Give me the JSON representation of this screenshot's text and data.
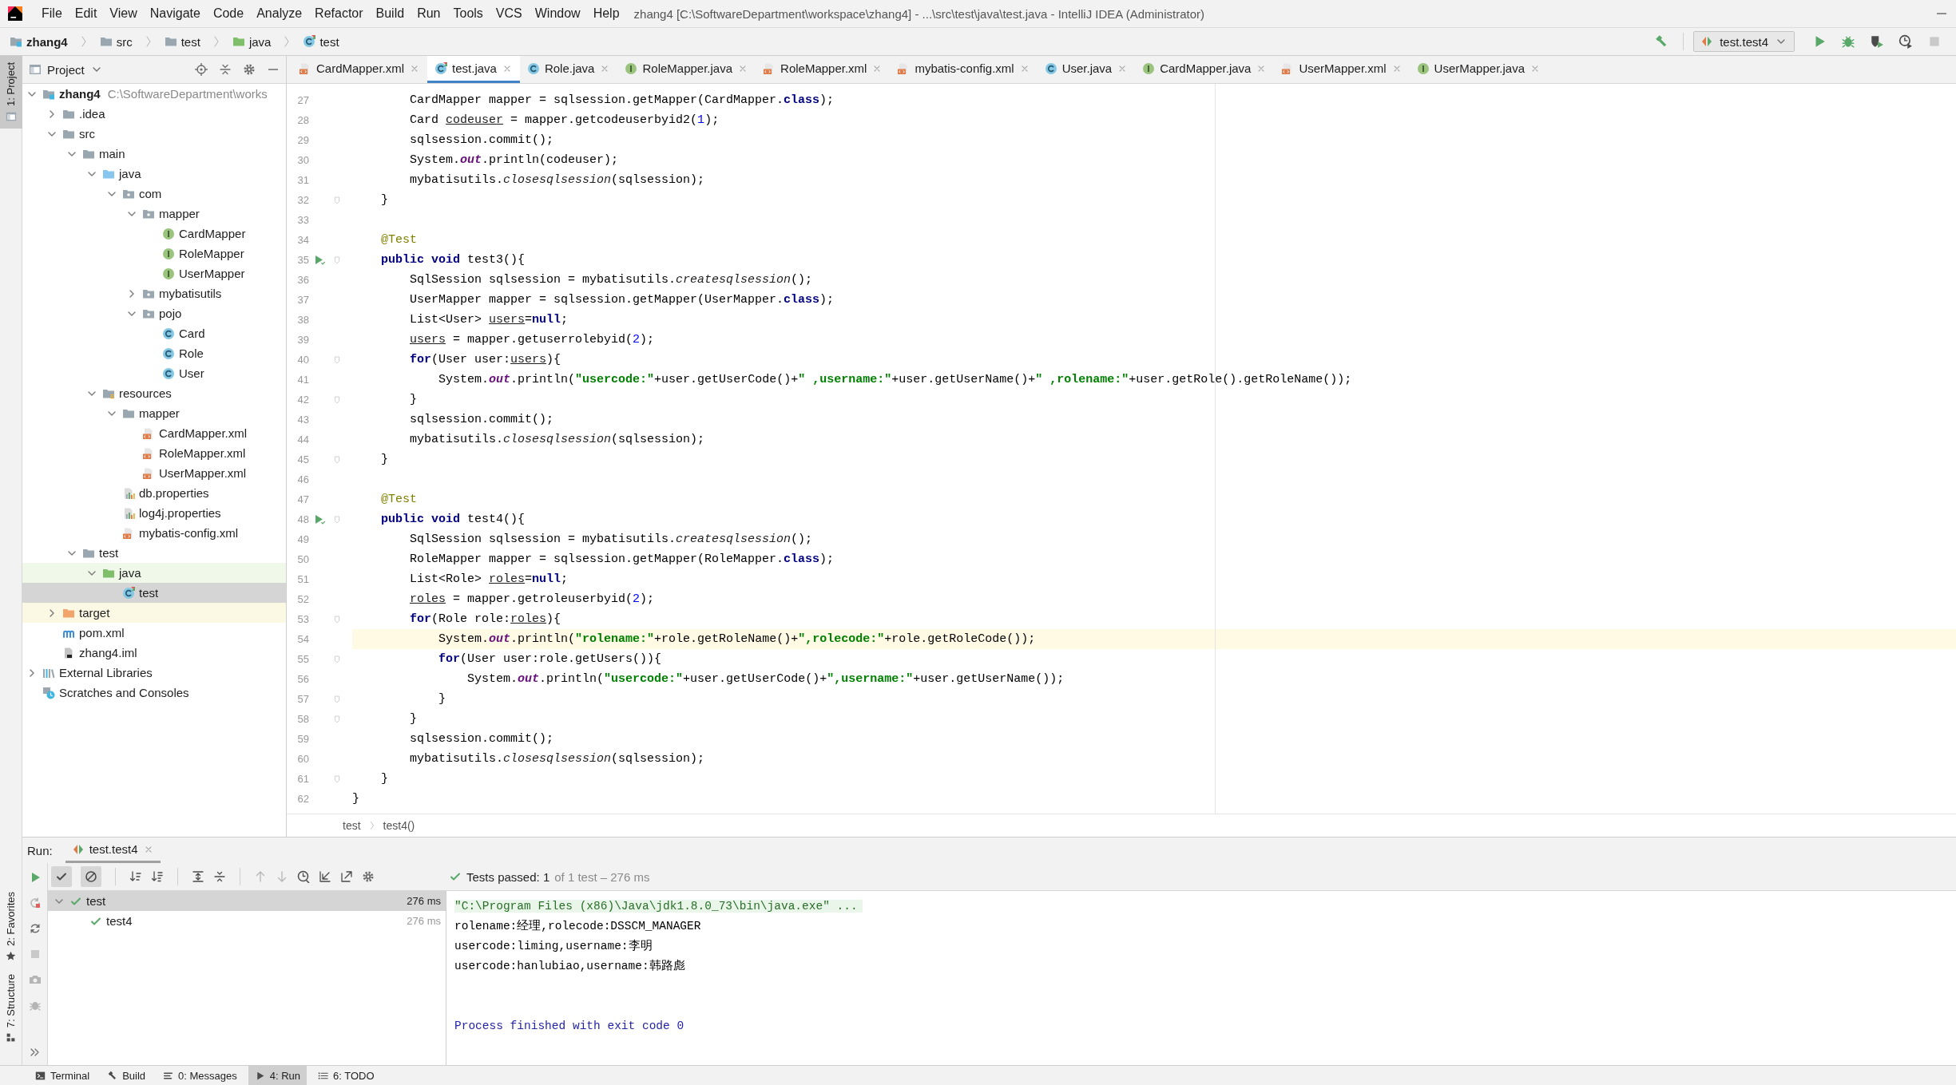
{
  "title_bar": {
    "menu": [
      "File",
      "Edit",
      "View",
      "Navigate",
      "Code",
      "Analyze",
      "Refactor",
      "Build",
      "Run",
      "Tools",
      "VCS",
      "Window",
      "Help"
    ],
    "title": "zhang4 [C:\\SoftwareDepartment\\workspace\\zhang4] - ...\\src\\test\\java\\test.java - IntelliJ IDEA (Administrator)"
  },
  "navigation": {
    "breadcrumbs": [
      {
        "label": "zhang4",
        "kind": "module"
      },
      {
        "label": "src",
        "kind": "folder"
      },
      {
        "label": "test",
        "kind": "folder"
      },
      {
        "label": "java",
        "kind": "test-source-folder"
      },
      {
        "label": "test",
        "kind": "test-class"
      }
    ],
    "run_configuration": "test.test4"
  },
  "tool_strip": {
    "top": [
      {
        "label": "1: Project",
        "selected": true
      }
    ],
    "bottom": [
      {
        "label": "2: Favorites",
        "kind": "favorites",
        "selected": false
      },
      {
        "label": "7: Structure",
        "kind": "structure",
        "selected": false
      }
    ]
  },
  "project": {
    "title": "Project",
    "tree": [
      {
        "name": "zhang4",
        "path": "C:\\SoftwareDepartment\\works",
        "kind": "module",
        "expanded": true,
        "selected": false,
        "children": [
          {
            "name": ".idea",
            "kind": "folder",
            "expanded": false,
            "selected": false
          },
          {
            "name": "src",
            "kind": "folder",
            "expanded": true,
            "selected": false,
            "children": [
              {
                "name": "main",
                "kind": "folder",
                "expanded": true,
                "selected": false,
                "children": [
                  {
                    "name": "java",
                    "kind": "source-folder",
                    "expanded": true,
                    "selected": false,
                    "children": [
                      {
                        "name": "com",
                        "kind": "package",
                        "expanded": true,
                        "selected": false,
                        "children": [
                          {
                            "name": "mapper",
                            "kind": "package",
                            "expanded": true,
                            "selected": false,
                            "children": [
                              {
                                "name": "CardMapper",
                                "kind": "interface",
                                "selected": false
                              },
                              {
                                "name": "RoleMapper",
                                "kind": "interface",
                                "selected": false
                              },
                              {
                                "name": "UserMapper",
                                "kind": "interface",
                                "selected": false
                              }
                            ]
                          },
                          {
                            "name": "mybatisutils",
                            "kind": "package",
                            "expanded": false,
                            "selected": false
                          },
                          {
                            "name": "pojo",
                            "kind": "package",
                            "expanded": true,
                            "selected": false,
                            "children": [
                              {
                                "name": "Card",
                                "kind": "class",
                                "selected": false
                              },
                              {
                                "name": "Role",
                                "kind": "class",
                                "selected": false
                              },
                              {
                                "name": "User",
                                "kind": "class",
                                "selected": false
                              }
                            ]
                          }
                        ]
                      }
                    ]
                  },
                  {
                    "name": "resources",
                    "kind": "resources-folder",
                    "expanded": true,
                    "selected": false,
                    "children": [
                      {
                        "name": "mapper",
                        "kind": "folder",
                        "expanded": true,
                        "selected": false,
                        "children": [
                          {
                            "name": "CardMapper.xml",
                            "kind": "xml",
                            "selected": false
                          },
                          {
                            "name": "RoleMapper.xml",
                            "kind": "xml",
                            "selected": false
                          },
                          {
                            "name": "UserMapper.xml",
                            "kind": "xml",
                            "selected": false
                          }
                        ]
                      },
                      {
                        "name": "db.properties",
                        "kind": "properties",
                        "selected": false
                      },
                      {
                        "name": "log4j.properties",
                        "kind": "properties",
                        "selected": false
                      },
                      {
                        "name": "mybatis-config.xml",
                        "kind": "xml",
                        "selected": false
                      }
                    ]
                  }
                ]
              },
              {
                "name": "test",
                "kind": "folder",
                "expanded": true,
                "selected": false,
                "children": [
                  {
                    "name": "java",
                    "kind": "test-source-folder",
                    "expanded": true,
                    "selected": false,
                    "children": [
                      {
                        "name": "test",
                        "kind": "test-class",
                        "selected": true
                      }
                    ]
                  }
                ]
              }
            ]
          },
          {
            "name": "target",
            "kind": "excluded-folder",
            "expanded": false,
            "selected": false
          },
          {
            "name": "pom.xml",
            "kind": "pom",
            "selected": false
          },
          {
            "name": "zhang4.iml",
            "kind": "iml",
            "selected": false
          }
        ]
      },
      {
        "name": "External Libraries",
        "kind": "libraries",
        "expanded": false,
        "selected": false
      },
      {
        "name": "Scratches and Consoles",
        "kind": "scratches",
        "selected": false
      }
    ]
  },
  "editor": {
    "tabs": [
      {
        "label": "CardMapper.xml",
        "kind": "xml",
        "selected": false
      },
      {
        "label": "test.java",
        "kind": "test-class",
        "selected": true
      },
      {
        "label": "Role.java",
        "kind": "class",
        "selected": false
      },
      {
        "label": "RoleMapper.java",
        "kind": "interface",
        "selected": false
      },
      {
        "label": "RoleMapper.xml",
        "kind": "xml",
        "selected": false
      },
      {
        "label": "mybatis-config.xml",
        "kind": "xml",
        "selected": false
      },
      {
        "label": "User.java",
        "kind": "class",
        "selected": false
      },
      {
        "label": "CardMapper.java",
        "kind": "interface",
        "selected": false
      },
      {
        "label": "UserMapper.xml",
        "kind": "xml",
        "selected": false
      },
      {
        "label": "UserMapper.java",
        "kind": "interface",
        "selected": false
      }
    ],
    "lines": [
      {
        "number": "27",
        "tokens": [
          {
            "kind": "plain",
            "text": "        CardMapper mapper = sqlsession.getMapper(CardMapper."
          },
          {
            "kind": "keyword",
            "text": "class"
          },
          {
            "kind": "plain",
            "text": ");"
          }
        ]
      },
      {
        "number": "28",
        "tokens": [
          {
            "kind": "plain",
            "text": "        Card "
          },
          {
            "kind": "reassigned",
            "text": "codeuser"
          },
          {
            "kind": "plain",
            "text": " = mapper.getcodeuserbyid2("
          },
          {
            "kind": "number",
            "text": "1"
          },
          {
            "kind": "plain",
            "text": ");"
          }
        ]
      },
      {
        "number": "29",
        "tokens": [
          {
            "kind": "plain",
            "text": "        sqlsession.commit();"
          }
        ]
      },
      {
        "number": "30",
        "tokens": [
          {
            "kind": "plain",
            "text": "        System."
          },
          {
            "kind": "static-field",
            "text": "out"
          },
          {
            "kind": "plain",
            "text": ".println(codeuser);"
          }
        ]
      },
      {
        "number": "31",
        "tokens": [
          {
            "kind": "plain",
            "text": "        mybatisutils."
          },
          {
            "kind": "static-call",
            "text": "closesqlsession"
          },
          {
            "kind": "plain",
            "text": "(sqlsession);"
          }
        ]
      },
      {
        "number": "32",
        "fold": true,
        "tokens": [
          {
            "kind": "plain",
            "text": "    }"
          }
        ]
      },
      {
        "number": "33"
      },
      {
        "number": "34",
        "tokens": [
          {
            "kind": "annotation",
            "text": "    @Test"
          }
        ]
      },
      {
        "number": "35",
        "run_marker": true,
        "fold": true,
        "tokens": [
          {
            "kind": "keyword",
            "text": "    public void"
          },
          {
            "kind": "plain",
            "text": " test3(){"
          }
        ]
      },
      {
        "number": "36",
        "tokens": [
          {
            "kind": "plain",
            "text": "        SqlSession sqlsession = mybatisutils."
          },
          {
            "kind": "static-call",
            "text": "createsqlsession"
          },
          {
            "kind": "plain",
            "text": "();"
          }
        ]
      },
      {
        "number": "37",
        "tokens": [
          {
            "kind": "plain",
            "text": "        UserMapper mapper = sqlsession.getMapper(UserMapper."
          },
          {
            "kind": "keyword",
            "text": "class"
          },
          {
            "kind": "plain",
            "text": ");"
          }
        ]
      },
      {
        "number": "38",
        "tokens": [
          {
            "kind": "plain",
            "text": "        List<User> "
          },
          {
            "kind": "reassigned",
            "text": "users"
          },
          {
            "kind": "plain",
            "text": "="
          },
          {
            "kind": "keyword",
            "text": "null"
          },
          {
            "kind": "plain",
            "text": ";"
          }
        ]
      },
      {
        "number": "39",
        "tokens": [
          {
            "kind": "reassigned",
            "text": "        users"
          },
          {
            "kind": "plain",
            "text": " = mapper.getuserrolebyid("
          },
          {
            "kind": "number",
            "text": "2"
          },
          {
            "kind": "plain",
            "text": ");"
          }
        ]
      },
      {
        "number": "40",
        "fold": true,
        "tokens": [
          {
            "kind": "keyword",
            "text": "        for"
          },
          {
            "kind": "plain",
            "text": "(User user:"
          },
          {
            "kind": "reassigned",
            "text": "users"
          },
          {
            "kind": "plain",
            "text": "){"
          }
        ]
      },
      {
        "number": "41",
        "tokens": [
          {
            "kind": "plain",
            "text": "            System."
          },
          {
            "kind": "static-field",
            "text": "out"
          },
          {
            "kind": "plain",
            "text": ".println("
          },
          {
            "kind": "string",
            "text": "\"usercode:\""
          },
          {
            "kind": "plain",
            "text": "+user.getUserCode()+"
          },
          {
            "kind": "string",
            "text": "\" ,username:\""
          },
          {
            "kind": "plain",
            "text": "+user.getUserName()+"
          },
          {
            "kind": "string",
            "text": "\" ,rolename:\""
          },
          {
            "kind": "plain",
            "text": "+user.getRole().getRoleName());"
          }
        ]
      },
      {
        "number": "42",
        "fold": true,
        "tokens": [
          {
            "kind": "plain",
            "text": "        }"
          }
        ]
      },
      {
        "number": "43",
        "tokens": [
          {
            "kind": "plain",
            "text": "        sqlsession.commit();"
          }
        ]
      },
      {
        "number": "44",
        "tokens": [
          {
            "kind": "plain",
            "text": "        mybatisutils."
          },
          {
            "kind": "static-call",
            "text": "closesqlsession"
          },
          {
            "kind": "plain",
            "text": "(sqlsession);"
          }
        ]
      },
      {
        "number": "45",
        "fold": true,
        "tokens": [
          {
            "kind": "plain",
            "text": "    }"
          }
        ]
      },
      {
        "number": "46"
      },
      {
        "number": "47",
        "tokens": [
          {
            "kind": "annotation",
            "text": "    @Test"
          }
        ]
      },
      {
        "number": "48",
        "run_marker": true,
        "fold": true,
        "tokens": [
          {
            "kind": "keyword",
            "text": "    public void"
          },
          {
            "kind": "plain",
            "text": " test4(){"
          }
        ]
      },
      {
        "number": "49",
        "tokens": [
          {
            "kind": "plain",
            "text": "        SqlSession sqlsession = mybatisutils."
          },
          {
            "kind": "static-call",
            "text": "createsqlsession"
          },
          {
            "kind": "plain",
            "text": "();"
          }
        ]
      },
      {
        "number": "50",
        "tokens": [
          {
            "kind": "plain",
            "text": "        RoleMapper mapper = sqlsession.getMapper(RoleMapper."
          },
          {
            "kind": "keyword",
            "text": "class"
          },
          {
            "kind": "plain",
            "text": ");"
          }
        ]
      },
      {
        "number": "51",
        "tokens": [
          {
            "kind": "plain",
            "text": "        List<Role> "
          },
          {
            "kind": "reassigned",
            "text": "roles"
          },
          {
            "kind": "plain",
            "text": "="
          },
          {
            "kind": "keyword",
            "text": "null"
          },
          {
            "kind": "plain",
            "text": ";"
          }
        ]
      },
      {
        "number": "52",
        "tokens": [
          {
            "kind": "reassigned",
            "text": "        roles"
          },
          {
            "kind": "plain",
            "text": " = mapper.getroleuserbyid("
          },
          {
            "kind": "number",
            "text": "2"
          },
          {
            "kind": "plain",
            "text": ");"
          }
        ]
      },
      {
        "number": "53",
        "fold": true,
        "tokens": [
          {
            "kind": "keyword",
            "text": "        for"
          },
          {
            "kind": "plain",
            "text": "(Role role:"
          },
          {
            "kind": "reassigned",
            "text": "roles"
          },
          {
            "kind": "plain",
            "text": "){"
          }
        ]
      },
      {
        "number": "54",
        "current": true,
        "tokens": [
          {
            "kind": "plain",
            "text": "            System."
          },
          {
            "kind": "static-field",
            "text": "out"
          },
          {
            "kind": "plain",
            "text": ".println("
          },
          {
            "kind": "string",
            "text": "\"rolename:\""
          },
          {
            "kind": "plain",
            "text": "+role.getRoleName()+"
          },
          {
            "kind": "string",
            "text": "\",rolecode:\""
          },
          {
            "kind": "plain",
            "text": "+role.getRoleCode());"
          }
        ]
      },
      {
        "number": "55",
        "fold": true,
        "tokens": [
          {
            "kind": "keyword",
            "text": "            for"
          },
          {
            "kind": "plain",
            "text": "(User user:role.getUsers()){"
          }
        ]
      },
      {
        "number": "56",
        "tokens": [
          {
            "kind": "plain",
            "text": "                System."
          },
          {
            "kind": "static-field",
            "text": "out"
          },
          {
            "kind": "plain",
            "text": ".println("
          },
          {
            "kind": "string",
            "text": "\"usercode:\""
          },
          {
            "kind": "plain",
            "text": "+user.getUserCode()+"
          },
          {
            "kind": "string",
            "text": "\",username:\""
          },
          {
            "kind": "plain",
            "text": "+user.getUserName());"
          }
        ]
      },
      {
        "number": "57",
        "fold": true,
        "tokens": [
          {
            "kind": "plain",
            "text": "            }"
          }
        ]
      },
      {
        "number": "58",
        "fold": true,
        "tokens": [
          {
            "kind": "plain",
            "text": "        }"
          }
        ]
      },
      {
        "number": "59",
        "tokens": [
          {
            "kind": "plain",
            "text": "        sqlsession.commit();"
          }
        ]
      },
      {
        "number": "60",
        "tokens": [
          {
            "kind": "plain",
            "text": "        mybatisutils."
          },
          {
            "kind": "static-call",
            "text": "closesqlsession"
          },
          {
            "kind": "plain",
            "text": "(sqlsession);"
          }
        ]
      },
      {
        "number": "61",
        "fold": true,
        "tokens": [
          {
            "kind": "plain",
            "text": "    }"
          }
        ]
      },
      {
        "number": "62",
        "tokens": [
          {
            "kind": "plain",
            "text": "}"
          }
        ]
      }
    ],
    "breadcrumbs": [
      "test",
      "test4()"
    ]
  },
  "run": {
    "title": "Run:",
    "tab": "test.test4",
    "show_passed": true,
    "show_ignored": true,
    "status": "Tests passed: 1",
    "status_detail": "of 1 test – 276 ms",
    "tests": [
      {
        "name": "test",
        "time": "276 ms",
        "passed": true,
        "expanded": true,
        "selected": true,
        "children": [
          {
            "name": "test4",
            "time": "276 ms",
            "passed": true,
            "selected": false
          }
        ]
      }
    ],
    "console": [
      {
        "kind": "command",
        "text": "\"C:\\Program Files (x86)\\Java\\jdk1.8.0_73\\bin\\java.exe\" ..."
      },
      {
        "kind": "output",
        "text": "rolename:经理,rolecode:DSSCM_MANAGER"
      },
      {
        "kind": "output",
        "text": "usercode:liming,username:李明"
      },
      {
        "kind": "output",
        "text": "usercode:hanlubiao,username:韩路彪"
      },
      {
        "kind": "exit",
        "text": "Process finished with exit code 0"
      }
    ]
  },
  "bottom_tools": [
    {
      "label": "Terminal",
      "kind": "terminal",
      "selected": false
    },
    {
      "label": "Build",
      "kind": "build",
      "selected": false
    },
    {
      "label": "0: Messages",
      "kind": "messages",
      "selected": false
    },
    {
      "label": "4: Run",
      "kind": "run",
      "selected": true
    },
    {
      "label": "6: TODO",
      "kind": "todo",
      "selected": false
    }
  ]
}
